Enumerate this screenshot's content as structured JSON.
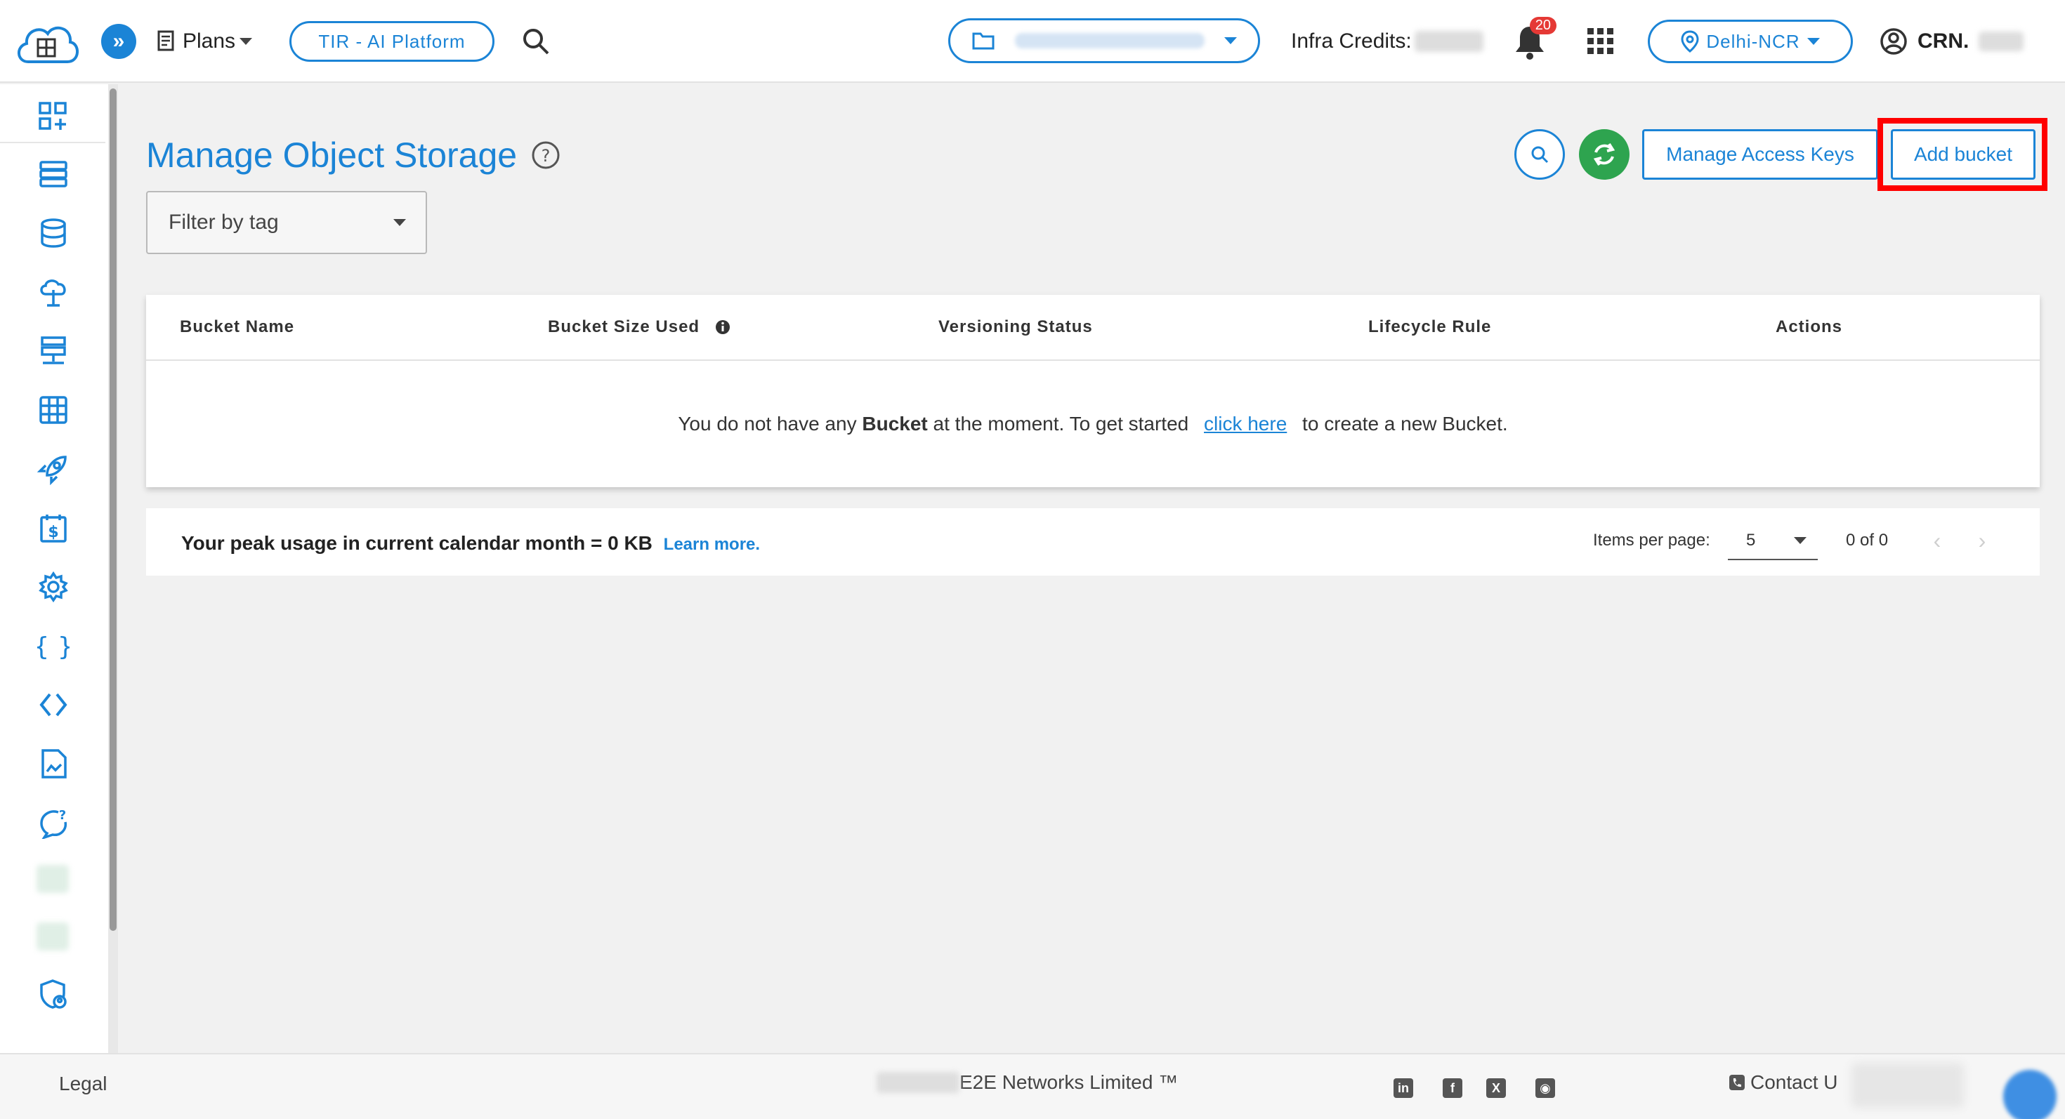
{
  "colors": {
    "accent": "#1b84d6",
    "refresh": "#2ea44f",
    "highlight": "#ff0000",
    "badge": "#e53935"
  },
  "header": {
    "logo_icon": "cloud-logo-icon",
    "plans_label": "Plans",
    "tir_label": "TIR - AI Platform",
    "infra_credits_label": "Infra Credits:",
    "notification_count": "20",
    "region_label": "Delhi-NCR",
    "user_label": "CRN."
  },
  "sidebar": {
    "icons": [
      "dashboard-icon",
      "server-icon",
      "database-icon",
      "cloud-upload-icon",
      "network-icon",
      "grid-icon",
      "rocket-icon",
      "billing-icon",
      "settings-icon",
      "braces-icon",
      "code-icon",
      "document-icon",
      "support-chat-icon",
      "shield-user-icon"
    ]
  },
  "main": {
    "title": "Manage Object Storage",
    "filter_placeholder": "Filter by tag",
    "manage_keys_label": "Manage Access Keys",
    "add_bucket_label": "Add bucket",
    "table": {
      "columns": [
        "Bucket Name",
        "Bucket Size Used",
        "Versioning Status",
        "Lifecycle Rule",
        "Actions"
      ],
      "empty_prefix": "You do not have any ",
      "empty_bold": "Bucket",
      "empty_middle": " at the moment. To get started ",
      "empty_link": "click here",
      "empty_suffix": " to create a new Bucket."
    },
    "usage": {
      "text": "Your peak usage in current calendar month = 0 KB",
      "learn_more": "Learn more."
    },
    "pagination": {
      "items_per_page_label": "Items per page:",
      "items_per_page_value": "5",
      "range": "0 of 0"
    }
  },
  "footer": {
    "legal": "Legal",
    "copyright": "E2E Networks Limited ™",
    "contact": "Contact U",
    "social_icons": [
      "linkedin-icon",
      "facebook-icon",
      "x-icon",
      "rss-icon"
    ]
  }
}
